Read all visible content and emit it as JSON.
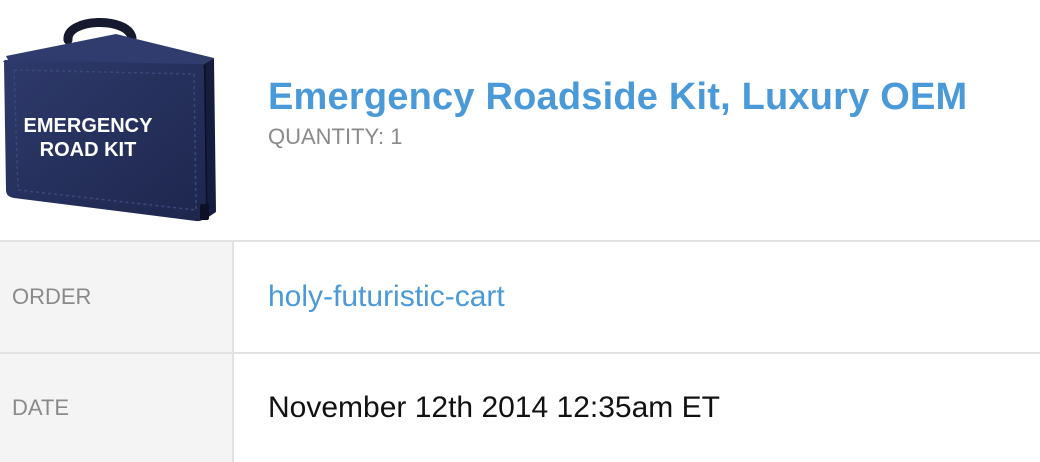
{
  "product": {
    "image_icon": "emergency-road-kit-bag",
    "image_text_line1": "EMERGENCY",
    "image_text_line2": "ROAD KIT",
    "title": "Emergency Roadside Kit, Luxury OEM",
    "quantity": "QUANTITY: 1"
  },
  "details": {
    "order_label": "ORDER",
    "order_value": "holy-futuristic-cart",
    "date_label": "DATE",
    "date_value": "November 12th 2014 12:35am ET"
  },
  "colors": {
    "accent": "#4a9ad9",
    "muted_text": "#8a8a8a",
    "label_bg": "#f4f4f4",
    "divider": "#e2e2e2",
    "bag": "#25305c"
  }
}
